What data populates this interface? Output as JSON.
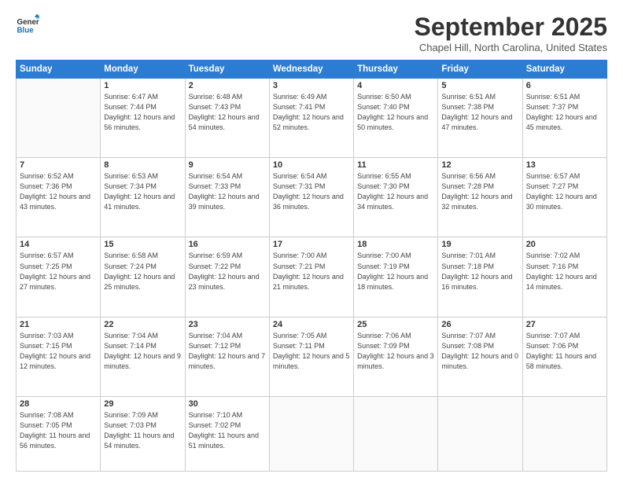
{
  "header": {
    "logo_general": "General",
    "logo_blue": "Blue",
    "month_title": "September 2025",
    "location": "Chapel Hill, North Carolina, United States"
  },
  "weekdays": [
    "Sunday",
    "Monday",
    "Tuesday",
    "Wednesday",
    "Thursday",
    "Friday",
    "Saturday"
  ],
  "weeks": [
    [
      {
        "day": "",
        "sunrise": "",
        "sunset": "",
        "daylight": ""
      },
      {
        "day": "1",
        "sunrise": "Sunrise: 6:47 AM",
        "sunset": "Sunset: 7:44 PM",
        "daylight": "Daylight: 12 hours and 56 minutes."
      },
      {
        "day": "2",
        "sunrise": "Sunrise: 6:48 AM",
        "sunset": "Sunset: 7:43 PM",
        "daylight": "Daylight: 12 hours and 54 minutes."
      },
      {
        "day": "3",
        "sunrise": "Sunrise: 6:49 AM",
        "sunset": "Sunset: 7:41 PM",
        "daylight": "Daylight: 12 hours and 52 minutes."
      },
      {
        "day": "4",
        "sunrise": "Sunrise: 6:50 AM",
        "sunset": "Sunset: 7:40 PM",
        "daylight": "Daylight: 12 hours and 50 minutes."
      },
      {
        "day": "5",
        "sunrise": "Sunrise: 6:51 AM",
        "sunset": "Sunset: 7:38 PM",
        "daylight": "Daylight: 12 hours and 47 minutes."
      },
      {
        "day": "6",
        "sunrise": "Sunrise: 6:51 AM",
        "sunset": "Sunset: 7:37 PM",
        "daylight": "Daylight: 12 hours and 45 minutes."
      }
    ],
    [
      {
        "day": "7",
        "sunrise": "Sunrise: 6:52 AM",
        "sunset": "Sunset: 7:36 PM",
        "daylight": "Daylight: 12 hours and 43 minutes."
      },
      {
        "day": "8",
        "sunrise": "Sunrise: 6:53 AM",
        "sunset": "Sunset: 7:34 PM",
        "daylight": "Daylight: 12 hours and 41 minutes."
      },
      {
        "day": "9",
        "sunrise": "Sunrise: 6:54 AM",
        "sunset": "Sunset: 7:33 PM",
        "daylight": "Daylight: 12 hours and 39 minutes."
      },
      {
        "day": "10",
        "sunrise": "Sunrise: 6:54 AM",
        "sunset": "Sunset: 7:31 PM",
        "daylight": "Daylight: 12 hours and 36 minutes."
      },
      {
        "day": "11",
        "sunrise": "Sunrise: 6:55 AM",
        "sunset": "Sunset: 7:30 PM",
        "daylight": "Daylight: 12 hours and 34 minutes."
      },
      {
        "day": "12",
        "sunrise": "Sunrise: 6:56 AM",
        "sunset": "Sunset: 7:28 PM",
        "daylight": "Daylight: 12 hours and 32 minutes."
      },
      {
        "day": "13",
        "sunrise": "Sunrise: 6:57 AM",
        "sunset": "Sunset: 7:27 PM",
        "daylight": "Daylight: 12 hours and 30 minutes."
      }
    ],
    [
      {
        "day": "14",
        "sunrise": "Sunrise: 6:57 AM",
        "sunset": "Sunset: 7:25 PM",
        "daylight": "Daylight: 12 hours and 27 minutes."
      },
      {
        "day": "15",
        "sunrise": "Sunrise: 6:58 AM",
        "sunset": "Sunset: 7:24 PM",
        "daylight": "Daylight: 12 hours and 25 minutes."
      },
      {
        "day": "16",
        "sunrise": "Sunrise: 6:59 AM",
        "sunset": "Sunset: 7:22 PM",
        "daylight": "Daylight: 12 hours and 23 minutes."
      },
      {
        "day": "17",
        "sunrise": "Sunrise: 7:00 AM",
        "sunset": "Sunset: 7:21 PM",
        "daylight": "Daylight: 12 hours and 21 minutes."
      },
      {
        "day": "18",
        "sunrise": "Sunrise: 7:00 AM",
        "sunset": "Sunset: 7:19 PM",
        "daylight": "Daylight: 12 hours and 18 minutes."
      },
      {
        "day": "19",
        "sunrise": "Sunrise: 7:01 AM",
        "sunset": "Sunset: 7:18 PM",
        "daylight": "Daylight: 12 hours and 16 minutes."
      },
      {
        "day": "20",
        "sunrise": "Sunrise: 7:02 AM",
        "sunset": "Sunset: 7:16 PM",
        "daylight": "Daylight: 12 hours and 14 minutes."
      }
    ],
    [
      {
        "day": "21",
        "sunrise": "Sunrise: 7:03 AM",
        "sunset": "Sunset: 7:15 PM",
        "daylight": "Daylight: 12 hours and 12 minutes."
      },
      {
        "day": "22",
        "sunrise": "Sunrise: 7:04 AM",
        "sunset": "Sunset: 7:14 PM",
        "daylight": "Daylight: 12 hours and 9 minutes."
      },
      {
        "day": "23",
        "sunrise": "Sunrise: 7:04 AM",
        "sunset": "Sunset: 7:12 PM",
        "daylight": "Daylight: 12 hours and 7 minutes."
      },
      {
        "day": "24",
        "sunrise": "Sunrise: 7:05 AM",
        "sunset": "Sunset: 7:11 PM",
        "daylight": "Daylight: 12 hours and 5 minutes."
      },
      {
        "day": "25",
        "sunrise": "Sunrise: 7:06 AM",
        "sunset": "Sunset: 7:09 PM",
        "daylight": "Daylight: 12 hours and 3 minutes."
      },
      {
        "day": "26",
        "sunrise": "Sunrise: 7:07 AM",
        "sunset": "Sunset: 7:08 PM",
        "daylight": "Daylight: 12 hours and 0 minutes."
      },
      {
        "day": "27",
        "sunrise": "Sunrise: 7:07 AM",
        "sunset": "Sunset: 7:06 PM",
        "daylight": "Daylight: 11 hours and 58 minutes."
      }
    ],
    [
      {
        "day": "28",
        "sunrise": "Sunrise: 7:08 AM",
        "sunset": "Sunset: 7:05 PM",
        "daylight": "Daylight: 11 hours and 56 minutes."
      },
      {
        "day": "29",
        "sunrise": "Sunrise: 7:09 AM",
        "sunset": "Sunset: 7:03 PM",
        "daylight": "Daylight: 11 hours and 54 minutes."
      },
      {
        "day": "30",
        "sunrise": "Sunrise: 7:10 AM",
        "sunset": "Sunset: 7:02 PM",
        "daylight": "Daylight: 11 hours and 51 minutes."
      },
      {
        "day": "",
        "sunrise": "",
        "sunset": "",
        "daylight": ""
      },
      {
        "day": "",
        "sunrise": "",
        "sunset": "",
        "daylight": ""
      },
      {
        "day": "",
        "sunrise": "",
        "sunset": "",
        "daylight": ""
      },
      {
        "day": "",
        "sunrise": "",
        "sunset": "",
        "daylight": ""
      }
    ]
  ]
}
